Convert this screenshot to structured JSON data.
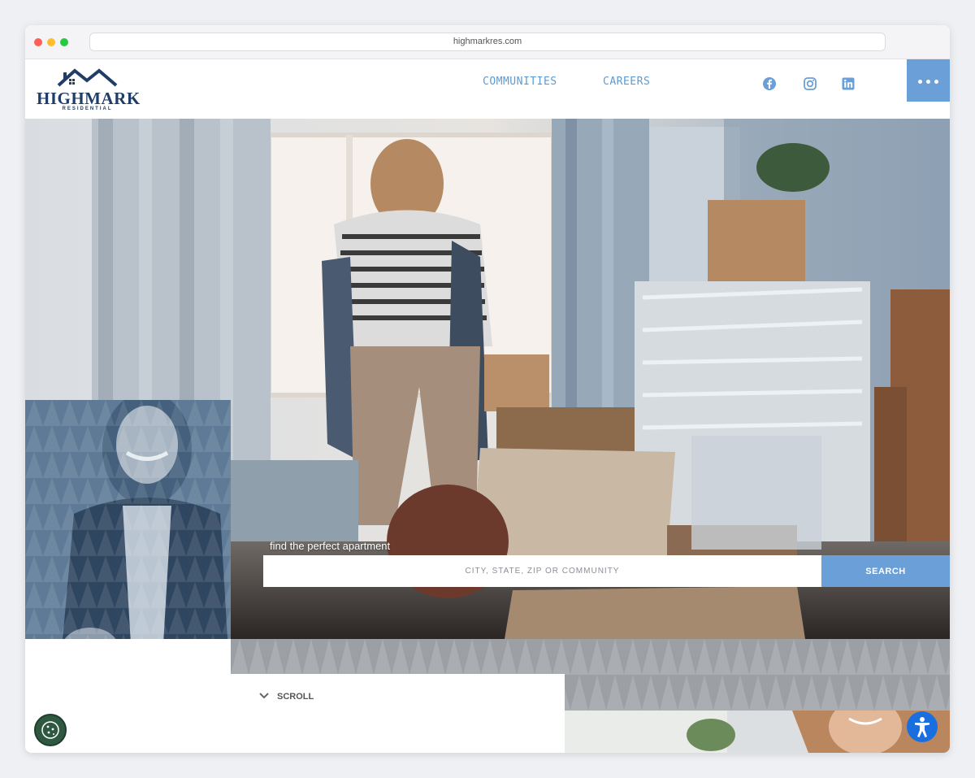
{
  "browser": {
    "url": "highmarkres.com"
  },
  "header": {
    "logo_main": "HIGHMARK",
    "logo_sub": "RESIDENTIAL",
    "nav": [
      {
        "label": "COMMUNITIES"
      },
      {
        "label": "CAREERS"
      }
    ],
    "social_icons": [
      "facebook-icon",
      "instagram-icon",
      "linkedin-icon"
    ],
    "menu_icon": "more-dots-icon"
  },
  "hero": {
    "search_label": "find the perfect apartment",
    "search_placeholder": "CITY, STATE, ZIP OR COMMUNITY",
    "search_button": "SEARCH"
  },
  "scroll": {
    "label": "SCROLL"
  },
  "floating": {
    "cookie_icon": "cookie-icon",
    "accessibility_icon": "accessibility-icon"
  },
  "colors": {
    "brand_navy": "#1f3d66",
    "accent_blue": "#6a9fd8",
    "nav_blue": "#5a9bd5",
    "cookie_green": "#2e5940",
    "accessibility_blue": "#1a6fe0"
  }
}
